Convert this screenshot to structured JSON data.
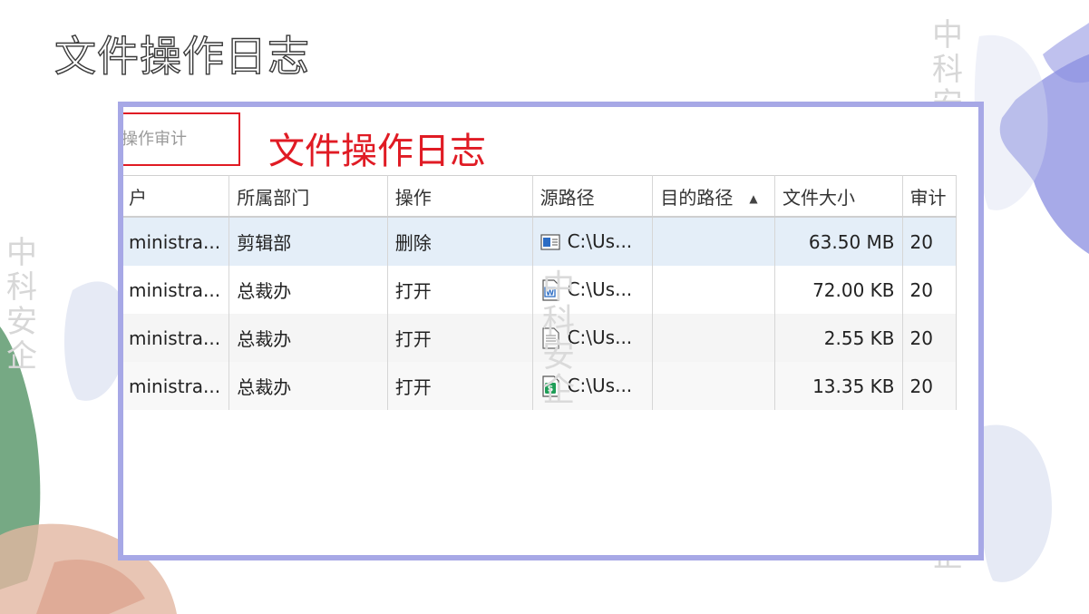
{
  "slide": {
    "title": "文件操作日志"
  },
  "panel": {
    "tab_label": "件操作审计",
    "annotation": "文件操作日志"
  },
  "table": {
    "columns": [
      {
        "label": "户"
      },
      {
        "label": "所属部门"
      },
      {
        "label": "操作"
      },
      {
        "label": "源路径"
      },
      {
        "label": "目的路径",
        "sort": "ascending"
      },
      {
        "label": "文件大小"
      },
      {
        "label": "审计"
      }
    ],
    "rows": [
      {
        "user": "ministra...",
        "dept": "剪辑部",
        "op": "删除",
        "src": "C:\\Us...",
        "dst": "",
        "size": "63.50 MB",
        "time": "20",
        "icon": "video-file-icon"
      },
      {
        "user": "ministra...",
        "dept": "总裁办",
        "op": "打开",
        "src": "C:\\Us...",
        "dst": "",
        "size": "72.00 KB",
        "time": "20",
        "icon": "word-file-icon"
      },
      {
        "user": "ministra...",
        "dept": "总裁办",
        "op": "打开",
        "src": "C:\\Us...",
        "dst": "",
        "size": "2.55 KB",
        "time": "20",
        "icon": "text-file-icon"
      },
      {
        "user": "ministra...",
        "dept": "总裁办",
        "op": "打开",
        "src": "C:\\Us...",
        "dst": "",
        "size": "13.35 KB",
        "time": "20",
        "icon": "spreadsheet-file-icon"
      }
    ]
  },
  "watermark": {
    "text": "中科安企"
  },
  "colors": {
    "frame": "#a7a8e6",
    "annotation_red": "#e01b24",
    "selected_row": "#e4eef8",
    "brush_purple": "#8a8ee0",
    "brush_green": "#5e9a6f"
  }
}
